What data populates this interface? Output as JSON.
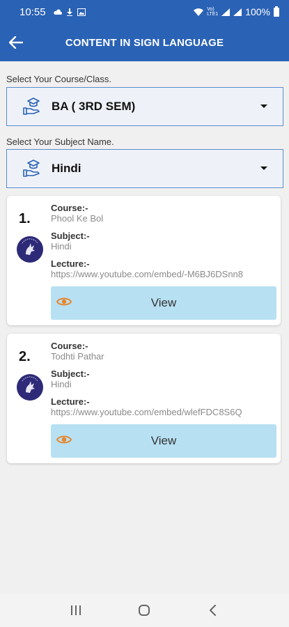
{
  "status_bar": {
    "time": "10:55",
    "network": "Vo) LTE1",
    "battery": "100%"
  },
  "app_bar": {
    "title": "CONTENT IN SIGN LANGUAGE"
  },
  "course_select": {
    "label": "Select Your  Course/Class.",
    "value": "BA ( 3RD SEM)"
  },
  "subject_select": {
    "label": "Select Your Subject Name.",
    "value": "Hindi"
  },
  "lectures": [
    {
      "number": "1.",
      "course_label": "Course:-",
      "course": "Phool Ke Bol",
      "subject_label": "Subject:-",
      "subject": "Hindi",
      "lecture_label": "Lecture:-",
      "lecture": "https://www.youtube.com/embed/-M6BJ6DSnn8",
      "view_label": "View"
    },
    {
      "number": "2.",
      "course_label": "Course:-",
      "course": "Todhti Pathar",
      "subject_label": "Subject:-",
      "subject": "Hindi",
      "lecture_label": "Lecture:-",
      "lecture": "https://www.youtube.com/embed/wlefFDC8S6Q",
      "view_label": "View"
    }
  ],
  "colors": {
    "primary": "#2a62b5",
    "view_button": "#b7e0f3",
    "eye_icon": "#e8862a"
  },
  "icons": [
    "back-arrow-icon",
    "graduation-hand-icon",
    "dropdown-arrow-icon",
    "eye-icon",
    "recent-apps-icon",
    "home-icon",
    "system-back-icon"
  ]
}
